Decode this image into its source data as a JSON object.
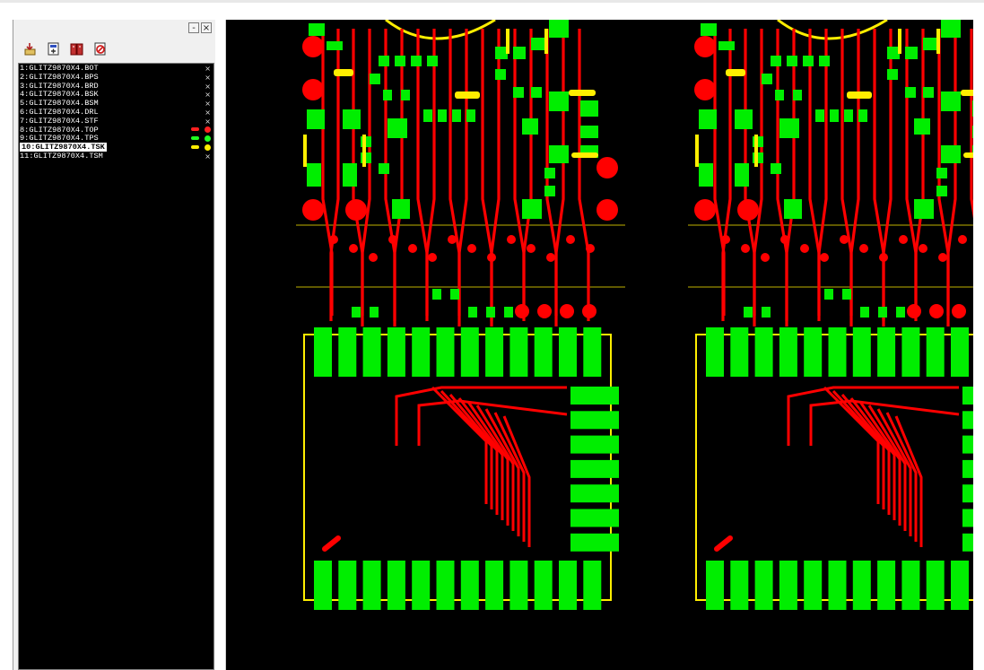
{
  "colors": {
    "board_background": "#000000",
    "top_copper": "#ff0000",
    "top_pad": "#00ee00",
    "outline": "#ffee00"
  },
  "panel": {
    "controls": [
      {
        "icon": "minimize-glyph",
        "label": "-"
      },
      {
        "icon": "close-glyph",
        "label": "×"
      }
    ],
    "toolbar": [
      {
        "icon": "open-file-icon"
      },
      {
        "icon": "add-layer-icon"
      },
      {
        "icon": "book-icon"
      },
      {
        "icon": "delete-layer-icon"
      }
    ],
    "layers": [
      {
        "label": "1:GLITZ9870X4.BOT",
        "status": "×"
      },
      {
        "label": "2:GLITZ9870X4.BPS",
        "status": "×"
      },
      {
        "label": "3:GLITZ9870X4.BRD",
        "status": "×"
      },
      {
        "label": "4:GLITZ9870X4.BSK",
        "status": "×"
      },
      {
        "label": "5:GLITZ9870X4.BSM",
        "status": "×"
      },
      {
        "label": "6:GLITZ9870X4.DRL",
        "status": "×"
      },
      {
        "label": "7:GLITZ9870X4.STF",
        "status": "×"
      },
      {
        "label": "8:GLITZ9870X4.TOP",
        "status": "",
        "swatch": "#ff2020"
      },
      {
        "label": "9:GLITZ9870X4.TPS",
        "status": "",
        "swatch": "#20ff20"
      },
      {
        "label": "10:GLITZ9870X4.TSK",
        "status": "",
        "swatch": "#ffee00",
        "selected": true
      },
      {
        "label": "11:GLITZ9870X4.TSM",
        "status": "×"
      }
    ]
  }
}
